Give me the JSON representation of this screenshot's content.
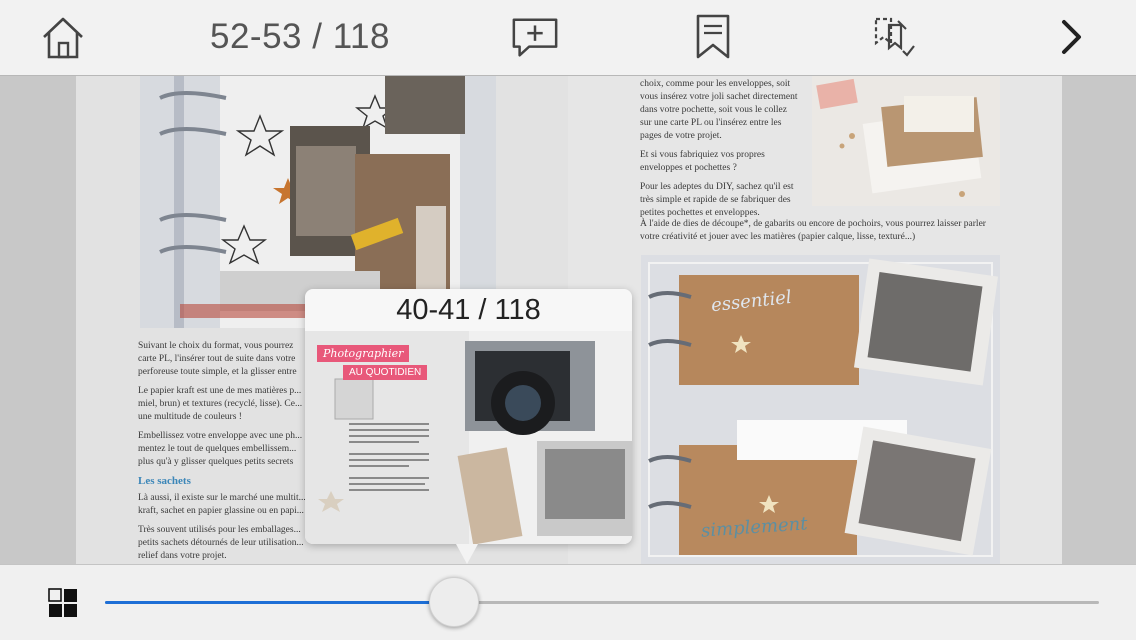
{
  "toolbar": {
    "home_icon": "home-icon",
    "page_counter": "52-53 / 118",
    "add_note_icon": "add-comment-icon",
    "bookmark_icon": "bookmark-icon",
    "bookmarks_list_icon": "bookmarks-list-icon",
    "next_icon": "chevron-right-icon"
  },
  "left_page": {
    "paragraphs": [
      "Suivant le choix du format, vous pourrez",
      "carte PL, l'insérer tout de suite dans votre",
      "perforeuse toute simple, et la glisser entre"
    ],
    "para2": "Le papier kraft est une de mes matières p... miel, brun) et textures (recyclé, lisse). Ce... une multitude de couleurs !",
    "para3": "Embellissez votre enveloppe avec une ph... mentez le tout de quelques embellissem... plus qu'à y glisser quelques petits secrets",
    "heading": "Les sachets",
    "para4": "Là aussi, il existe sur le marché une multit... kraft, sachet en papier glassine ou en papi...",
    "para5": "Très souvent utilisés pour les emballages... petits sachets détournés de leur utilisation... relief dans votre projet."
  },
  "right_page": {
    "para1": "choix, comme pour les enveloppes, soit vous insérez votre joli sachet directement dans votre pochette, soit vous le collez sur une carte PL ou l'insérez entre les pages de votre projet.",
    "para2": "Et si vous fabriquiez vos propres enveloppes et pochettes ?",
    "para3": "Pour les adeptes du DIY, sachez qu'il est très simple et rapide de se fabriquer des petites pochettes et enveloppes.",
    "para4": "À l'aide de dies de découpe*, de gabarits ou encore de pochoirs, vous pourrez laisser parler votre créativité et jouer avec les matières (papier calque, lisse, texturé...)",
    "photo_label_top": "essentiel",
    "photo_label_bottom": "simplement"
  },
  "preview": {
    "title": "40-41 / 118",
    "badge1": "Photographier",
    "badge2": "AU QUOTIDIEN"
  },
  "bottom": {
    "thumbnails_icon": "grid-icon",
    "slider_value": 0.35,
    "slider_label": ""
  },
  "colors": {
    "accent": "#1e6fd6",
    "heading": "#3b86b8",
    "badge": "#e8587a"
  }
}
